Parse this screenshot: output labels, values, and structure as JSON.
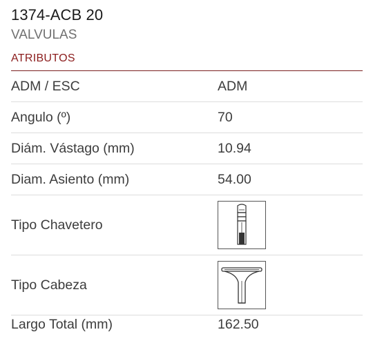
{
  "header": {
    "title": "1374-ACB 20",
    "subtitle": "VALVULAS"
  },
  "section": {
    "heading": "ATRIBUTOS"
  },
  "attributes": [
    {
      "label": "ADM / ESC",
      "value": "ADM"
    },
    {
      "label": "Angulo (º)",
      "value": "70"
    },
    {
      "label": "Diám. Vástago (mm)",
      "value": "10.94"
    },
    {
      "label": "Diam. Asiento (mm)",
      "value": "54.00"
    },
    {
      "label": "Tipo Chavetero",
      "image": "valve-keyway-drawing"
    },
    {
      "label": "Tipo Cabeza",
      "image": "valve-head-drawing"
    },
    {
      "label": "Largo Total (mm)",
      "value": "162.50"
    }
  ],
  "colors": {
    "accent": "#8b1c1c",
    "divider": "#dcdcdc",
    "text": "#3c3c3c"
  }
}
